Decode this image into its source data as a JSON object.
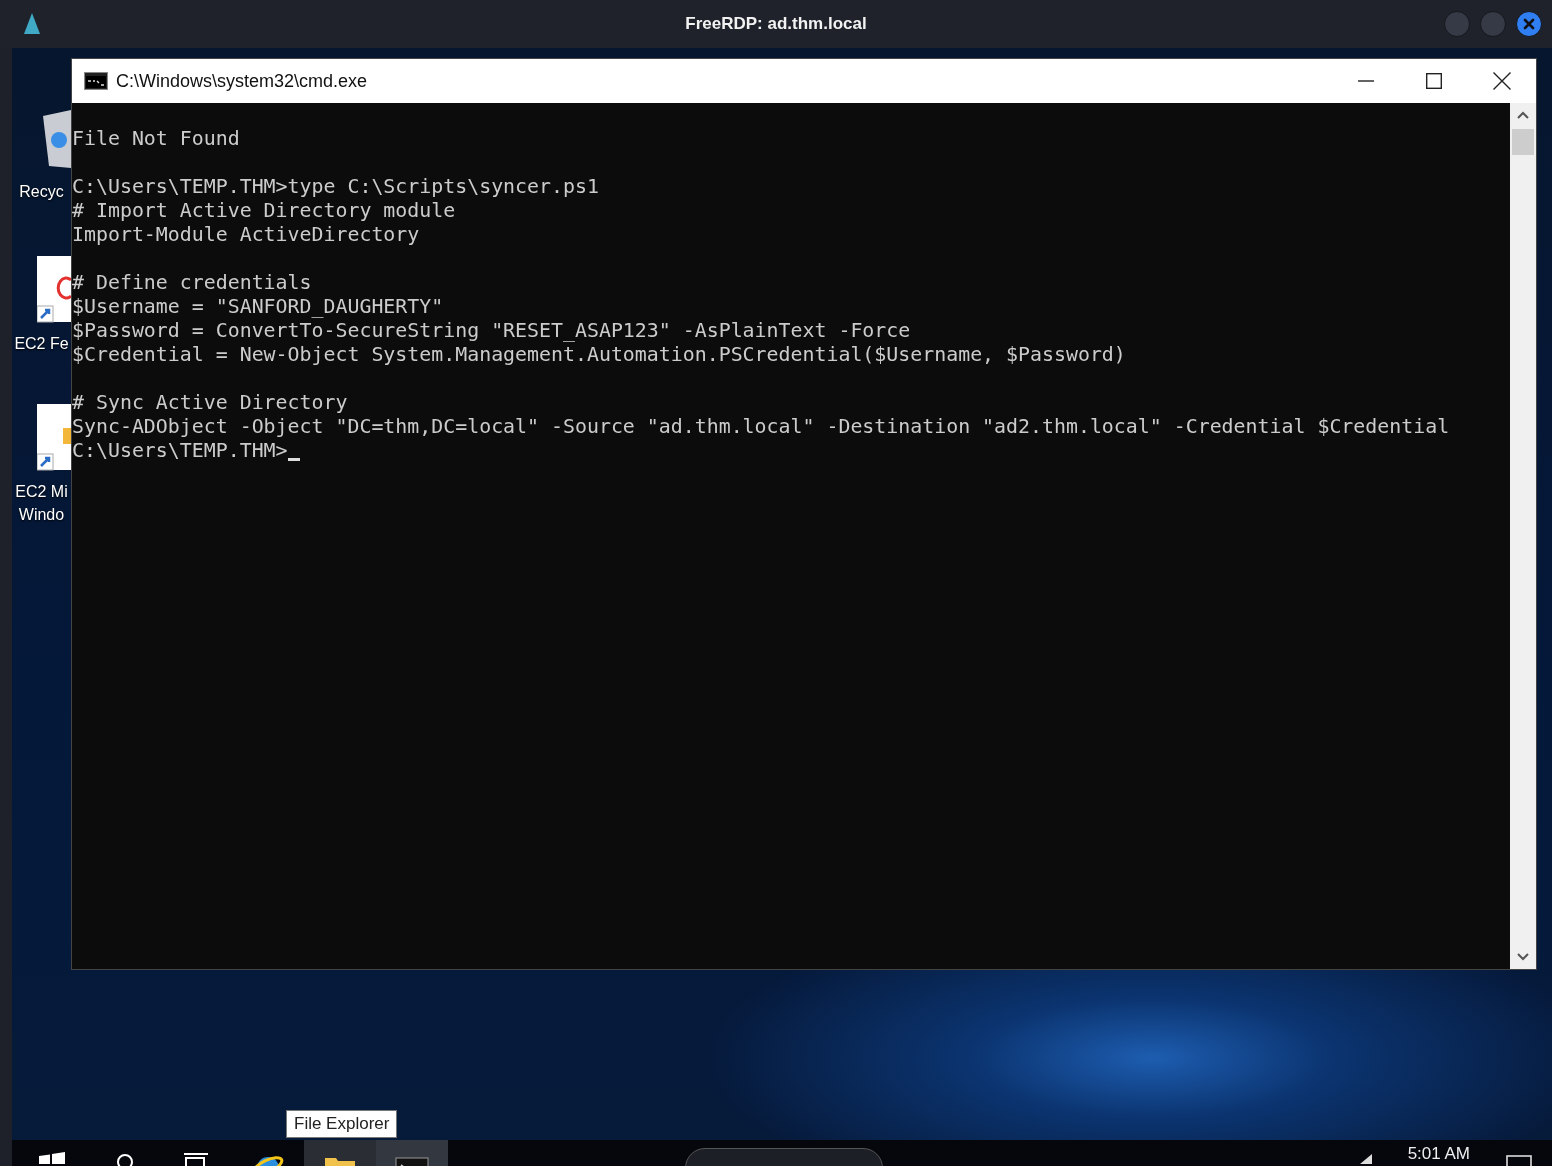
{
  "window": {
    "title": "FreeRDP: ad.thm.local"
  },
  "desktop_icons": [
    {
      "label": "Recyc",
      "kind": "recycle"
    },
    {
      "label": "EC2 Fe",
      "kind": "shortcut-red"
    },
    {
      "label": "EC2 Mi\nWindo",
      "kind": "shortcut-yellow"
    }
  ],
  "console_window": {
    "title": "C:\\Windows\\system32\\cmd.exe",
    "cursor": true,
    "blocks": [
      [
        "File Not Found"
      ],
      [
        "C:\\Users\\TEMP.THM>type C:\\Scripts\\syncer.ps1",
        "# Import Active Directory module",
        "Import-Module ActiveDirectory"
      ],
      [
        "# Define credentials",
        "$Username = \"SANFORD_DAUGHERTY\"",
        "$Password = ConvertTo-SecureString \"RESET_ASAP123\" -AsPlainText -Force",
        "$Credential = New-Object System.Management.Automation.PSCredential($Username, $Password)"
      ],
      [
        "# Sync Active Directory",
        "Sync-ADObject -Object \"DC=thm,DC=local\" -Source \"ad.thm.local\" -Destination \"ad2.thm.local\" -Credential $Credential",
        "C:\\Users\\TEMP.THM>"
      ]
    ]
  },
  "tooltip": "File Explorer",
  "taskbar": {
    "apps": [
      {
        "kind": "start",
        "selected": false
      },
      {
        "kind": "search",
        "selected": false
      },
      {
        "kind": "taskview",
        "selected": false
      },
      {
        "kind": "browser",
        "selected": false
      },
      {
        "kind": "folder",
        "selected": false
      },
      {
        "kind": "console",
        "selected": true
      }
    ],
    "clock": "5:01 AM"
  }
}
